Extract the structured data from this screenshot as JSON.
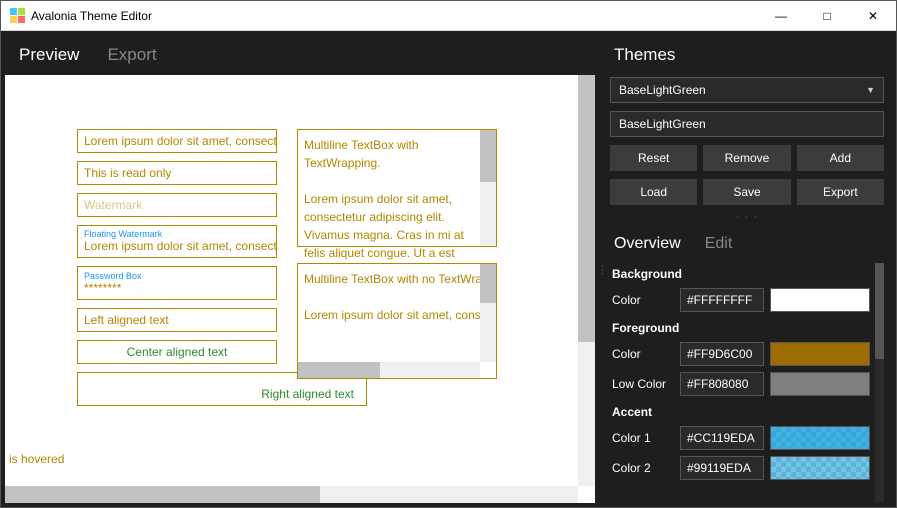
{
  "window": {
    "title": "Avalonia Theme Editor"
  },
  "tabs": {
    "preview": "Preview",
    "export": "Export"
  },
  "preview": {
    "tb1": "Lorem ipsum dolor sit amet, consect",
    "tb2": "This is read only",
    "tb3_placeholder": "Watermark",
    "tb4_label": "Floating Watermark",
    "tb4_value": "Lorem ipsum dolor sit amet, consect",
    "tb5_label": "Password Box",
    "tb5_value": "********",
    "tb6": "Left aligned text",
    "tb7": "Center aligned text",
    "tb8": "Right aligned text",
    "ml1_line1": "Multiline TextBox with TextWrapping.",
    "ml1_body": "Lorem ipsum dolor sit amet, consectetur adipiscing elit. Vivamus magna. Cras in mi at felis aliquet congue. Ut a est eget",
    "ml2_line1": "Multiline TextBox with no TextWrapp",
    "ml2_body": "Lorem ipsum dolor sit amet, consect",
    "hover": "is hovered"
  },
  "themes": {
    "heading": "Themes",
    "selected": "BaseLightGreen",
    "name_value": "BaseLightGreen",
    "buttons": {
      "reset": "Reset",
      "remove": "Remove",
      "add": "Add",
      "load": "Load",
      "save": "Save",
      "export": "Export"
    }
  },
  "editor_tabs": {
    "overview": "Overview",
    "edit": "Edit"
  },
  "props": {
    "background": {
      "label": "Background",
      "color_label": "Color",
      "color_value": "#FFFFFFFF"
    },
    "foreground": {
      "label": "Foreground",
      "color_label": "Color",
      "color_value": "#FF9D6C00",
      "low_label": "Low Color",
      "low_value": "#FF808080"
    },
    "accent": {
      "label": "Accent",
      "c1_label": "Color 1",
      "c1_value": "#CC119EDA",
      "c2_label": "Color 2",
      "c2_value": "#99119EDA"
    }
  }
}
